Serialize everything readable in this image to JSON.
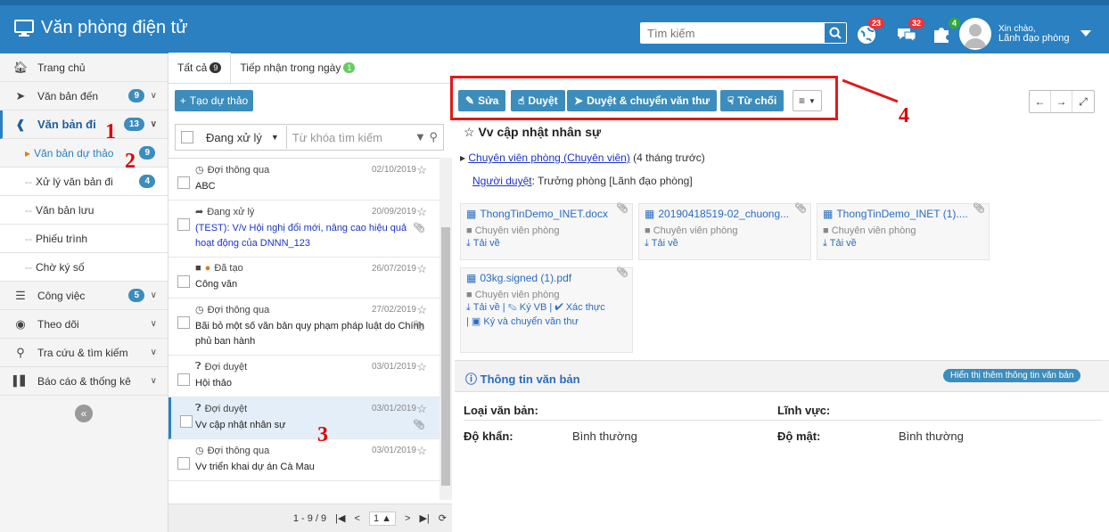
{
  "header": {
    "title": "Văn phòng điện tử",
    "search_placeholder": "Tìm kiếm",
    "notif_count": "23",
    "chat_count": "32",
    "plugin_count": "4",
    "greeting": "Xin chào,",
    "user_role": "Lãnh đạo phòng"
  },
  "sidebar": {
    "home": "Trang chủ",
    "incoming": {
      "label": "Văn bản đến",
      "count": "9"
    },
    "outgoing": {
      "label": "Văn bản đi",
      "count": "13"
    },
    "subs": [
      {
        "label": "Văn bản dự thảo",
        "count": "9"
      },
      {
        "label": "Xử lý văn bản đi",
        "count": "4"
      },
      {
        "label": "Văn bản lưu"
      },
      {
        "label": "Phiếu trình"
      },
      {
        "label": "Chờ ký số"
      }
    ],
    "work": {
      "label": "Công việc",
      "count": "5"
    },
    "follow": "Theo dõi",
    "search": "Tra cứu & tìm kiếm",
    "report": "Báo cáo & thống kê"
  },
  "annotations": {
    "n1": "1",
    "n2": "2",
    "n3": "3",
    "n4": "4"
  },
  "middle": {
    "tab_all": "Tất cả",
    "tab_all_count": "9",
    "tab_today": "Tiếp nhận trong ngày",
    "tab_today_count": "1",
    "new_draft": "Tạo dự thảo",
    "filter_status": "Đang xử lý",
    "keyword_placeholder": "Từ khóa tìm kiếm",
    "rows": [
      {
        "status": "Đợi thông qua",
        "date": "02/10/2019",
        "title": "ABC"
      },
      {
        "status": "Đang xử lý",
        "date": "20/09/2019",
        "title": "(TEST): V/v Hội nghị đổi mới, nâng cao hiệu quả hoạt động của DNNN_123"
      },
      {
        "status": "Đã tạo",
        "date": "26/07/2019",
        "title": "Công văn"
      },
      {
        "status": "Đợi thông qua",
        "date": "27/02/2019",
        "title": "Bãi bỏ một số văn bản quy phạm pháp luật do Chính phủ ban hành"
      },
      {
        "status": "Đợi duyệt",
        "date": "03/01/2019",
        "title": "Hội thảo"
      },
      {
        "status": "Đợi duyệt",
        "date": "03/01/2019",
        "title": "Vv cập nhật nhân sự"
      },
      {
        "status": "Đợi thông qua",
        "date": "03/01/2019",
        "title": "Vv triển khai dự án Cà Mau"
      }
    ],
    "pager_range": "1 - 9 / 9",
    "pager_page": "1"
  },
  "toolbar": {
    "edit": "Sửa",
    "approve": "Duyệt",
    "approve_forward": "Duyệt & chuyển văn thư",
    "reject": "Từ chối"
  },
  "detail": {
    "title": "Vv cập nhật nhân sự",
    "sender": "Chuyên viên phòng (Chuyên viên)",
    "sender_time": "(4 tháng trước)",
    "approver_label": "Người duyệt",
    "approver": ": Trưởng phòng [Lãnh đạo phòng]",
    "attachments": [
      {
        "name": "ThongTinDemo_INET.docx",
        "owner": "Chuyên viên phòng",
        "download": "Tải về"
      },
      {
        "name": "20190418519-02_chuong...",
        "owner": "Chuyên viên phòng",
        "download": "Tải về"
      },
      {
        "name": "ThongTinDemo_INET (1)....",
        "owner": "Chuyên viên phòng",
        "download": "Tải về"
      },
      {
        "name": "03kg.signed (1).pdf",
        "owner": "Chuyên viên phòng",
        "download": "Tải về",
        "sign": "Ký VB",
        "verify": "Xác thực",
        "sign_forward": "Ký và chuyển văn thư"
      }
    ],
    "info_title": "Thông tin văn bản",
    "info_more": "Hiển thị thêm thông tin văn bản",
    "doc_type_label": "Loại văn bản:",
    "field_label": "Lĩnh vực:",
    "urgency_label": "Độ khẩn:",
    "urgency_value": "Bình thường",
    "secrecy_label": "Độ mật:",
    "secrecy_value": "Bình thường"
  }
}
